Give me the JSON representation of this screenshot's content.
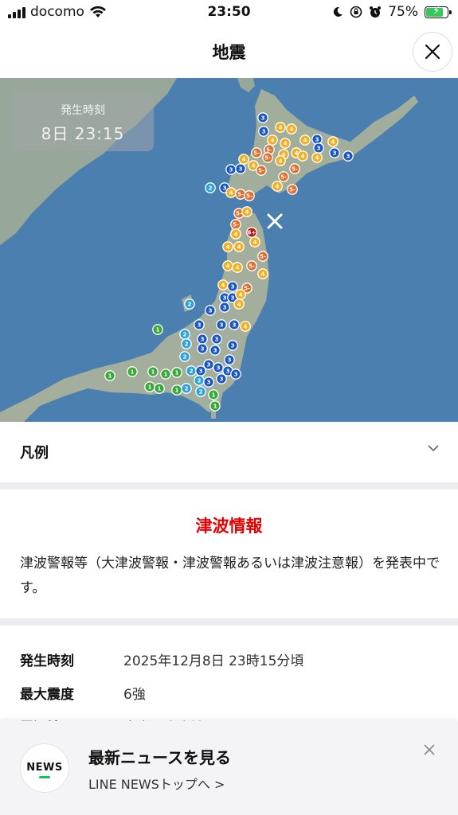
{
  "status_bar": {
    "carrier": "docomo",
    "time": "23:50",
    "battery": "75%"
  },
  "header": {
    "title": "地震"
  },
  "map": {
    "time_label": "発生時刻",
    "time_value": "8日 23:15",
    "epicenter_icon": "x-mark-icon",
    "intensity_colors": {
      "1": "#3aa83a",
      "2": "#2ea3d8",
      "3": "#1a56c4",
      "4": "#f0b020",
      "5-": "#e07030",
      "5+": "#e07030",
      "6+": "#b81818"
    }
  },
  "legend": {
    "label": "凡例"
  },
  "tsunami": {
    "title": "津波情報",
    "body": "津波警報等（大津波警報・津波警報あるいは津波注意報）を発表中です。"
  },
  "details": {
    "rows": [
      {
        "key": "発生時刻",
        "value": "2025年12月8日 23時15分頃"
      },
      {
        "key": "最大震度",
        "value": "6強"
      },
      {
        "key": "震源地",
        "value": "青森県東方沖"
      }
    ]
  },
  "news_banner": {
    "logo_text": "NEWS",
    "title": "最新ニュースを見る",
    "link": "LINE NEWSトップへ >"
  }
}
